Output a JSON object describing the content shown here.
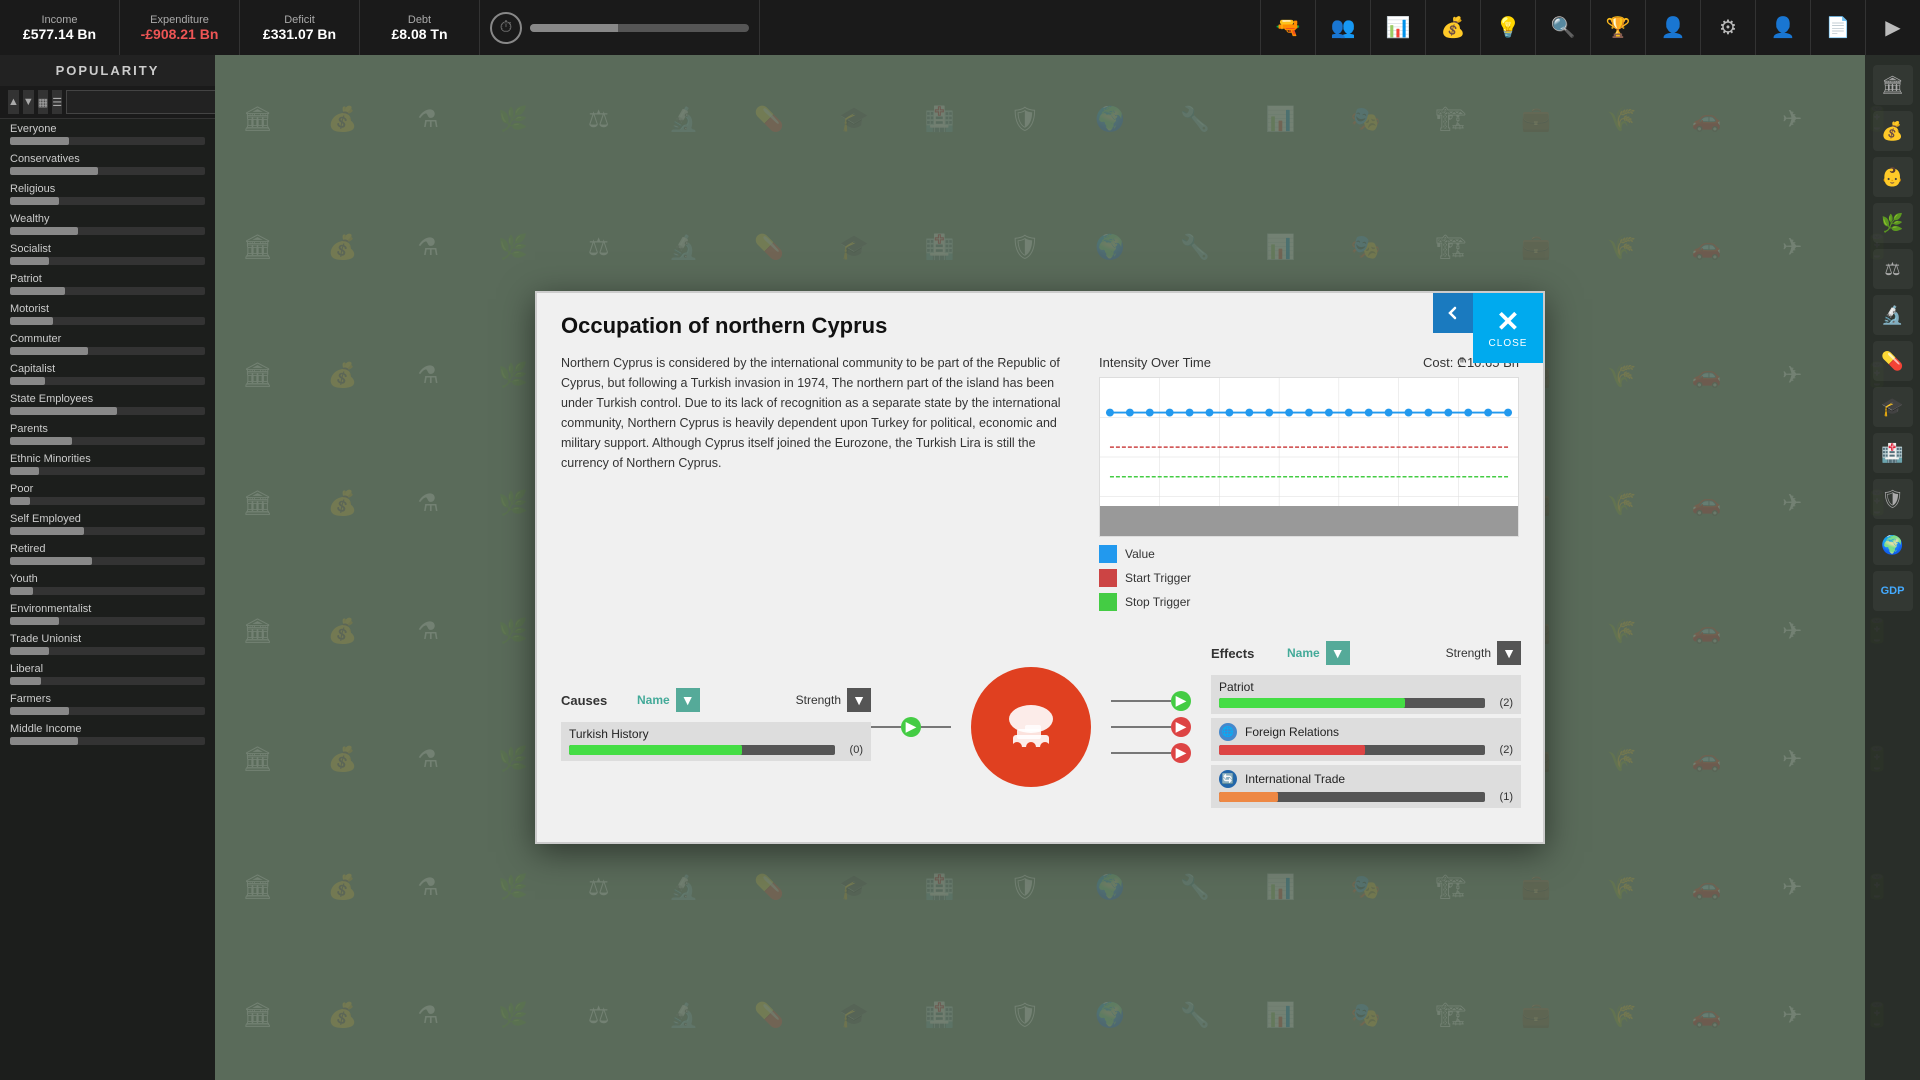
{
  "topbar": {
    "income_label": "Income",
    "income_value": "£577.14 Bn",
    "expenditure_label": "Expenditure",
    "expenditure_value": "-£908.21 Bn",
    "deficit_label": "Deficit",
    "deficit_value": "£331.07 Bn",
    "debt_label": "Debt",
    "debt_value": "£8.08 Tn"
  },
  "sidebar": {
    "title": "POPULARITY",
    "search_placeholder": "",
    "groups": [
      {
        "name": "Everyone",
        "bar": 30
      },
      {
        "name": "Conservatives",
        "bar": 45
      },
      {
        "name": "Religious",
        "bar": 25
      },
      {
        "name": "Wealthy",
        "bar": 35
      },
      {
        "name": "Socialist",
        "bar": 20
      },
      {
        "name": "Patriot",
        "bar": 28
      },
      {
        "name": "Motorist",
        "bar": 22
      },
      {
        "name": "Commuter",
        "bar": 40
      },
      {
        "name": "Capitalist",
        "bar": 18
      },
      {
        "name": "State Employees",
        "bar": 55
      },
      {
        "name": "Parents",
        "bar": 32
      },
      {
        "name": "Ethnic Minorities",
        "bar": 15
      },
      {
        "name": "Poor",
        "bar": 10
      },
      {
        "name": "Self Employed",
        "bar": 38
      },
      {
        "name": "Retired",
        "bar": 42
      },
      {
        "name": "Youth",
        "bar": 12
      },
      {
        "name": "Environmentalist",
        "bar": 25
      },
      {
        "name": "Trade Unionist",
        "bar": 20
      },
      {
        "name": "Liberal",
        "bar": 16
      },
      {
        "name": "Farmers",
        "bar": 30
      },
      {
        "name": "Middle Income",
        "bar": 35
      }
    ]
  },
  "modal": {
    "title": "Occupation of northern Cyprus",
    "description": "Northern Cyprus is considered by the international community to be part of the Republic of Cyprus, but following a Turkish invasion in 1974, The northern part of the island has been under Turkish control. Due to its lack of recognition as a separate state by the international community, Northern Cyprus is heavily dependent upon Turkey for political, economic and military support. Although Cyprus itself joined the Eurozone, the Turkish Lira is still the currency of Northern Cyprus.",
    "chart_title": "Intensity Over Time",
    "chart_cost": "Cost: ₾10.65 Bn",
    "legend": [
      {
        "label": "Value",
        "color": "#2299ee"
      },
      {
        "label": "Start Trigger",
        "color": "#cc4444"
      },
      {
        "label": "Stop Trigger",
        "color": "#44cc44"
      }
    ],
    "close_label": "CLOSE",
    "back_label": "←",
    "causes_title": "Causes",
    "causes_col": "Name",
    "causes_strength": "Strength",
    "causes_items": [
      {
        "name": "Turkish History",
        "value": 0,
        "bar_pct": 65,
        "bar_color": "green"
      }
    ],
    "effects_title": "Effects",
    "effects_col": "Name",
    "effects_strength": "Strength",
    "effects_items": [
      {
        "name": "Patriot",
        "value": 2,
        "bar_pct": 70,
        "bar_color": "green",
        "icon": null
      },
      {
        "name": "Foreign Relations",
        "value": 2,
        "bar_pct": 55,
        "bar_color": "red",
        "icon": "globe"
      },
      {
        "name": "International Trade",
        "value": 1,
        "bar_pct": 20,
        "bar_color": "orange",
        "icon": "trade"
      }
    ]
  },
  "toolbar_icons": [
    "🔫",
    "👥",
    "📊",
    "💰",
    "🔍",
    "🏆",
    "👤",
    "⚙",
    "👤",
    "📄",
    "▶"
  ],
  "right_icons": [
    "🏛",
    "💰",
    "👶",
    "🌿",
    "⚖",
    "🔬",
    "💊",
    "🎓",
    "🏥",
    "🛡",
    "🌍"
  ],
  "bg_icons": [
    "🏛",
    "💰",
    "⚗",
    "🌿",
    "⚖",
    "🔬",
    "💊",
    "🎓",
    "🏥",
    "🛡",
    "🌍",
    "🔧",
    "📊",
    "🎭",
    "🏗",
    "💼",
    "🌾",
    "🚗",
    "✈",
    "🔋"
  ]
}
